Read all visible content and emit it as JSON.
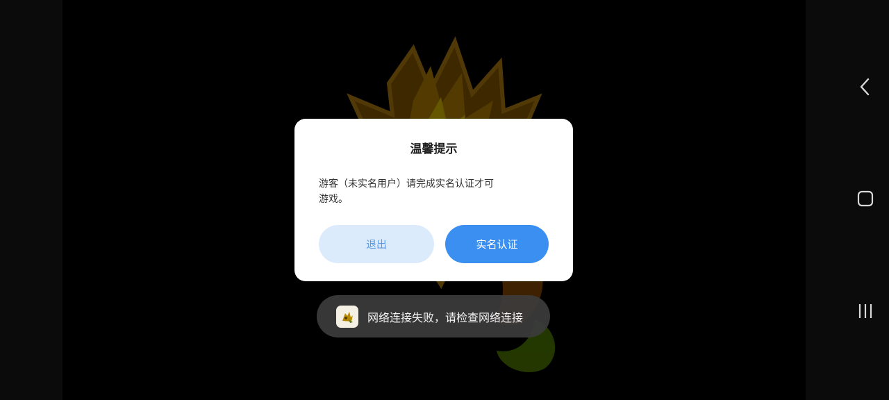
{
  "dialog": {
    "title": "温馨提示",
    "message": "游客（未实名用户）请完成实名认证才可游戏。",
    "exit_label": "退出",
    "verify_label": "实名认证"
  },
  "toast": {
    "text": "网络连接失败，请检查网络连接",
    "icon": "app-logo-icon"
  },
  "navigation": {
    "back_icon": "back-icon",
    "home_icon": "home-icon",
    "recent_icon": "recent-apps-icon"
  },
  "colors": {
    "dialog_bg": "#ffffff",
    "primary_button": "#3a8ff0",
    "secondary_button": "#dcebfc",
    "secondary_button_text": "#5b9be6",
    "toast_bg": "#3c3c3c"
  }
}
